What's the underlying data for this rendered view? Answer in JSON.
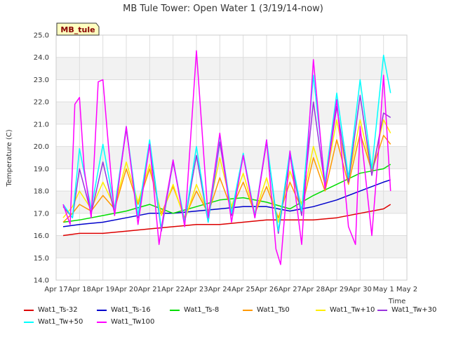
{
  "chart_data": {
    "type": "line",
    "title": "MB Tule Tower: Open Water 1 (3/19/14-now)",
    "station_label": "MB_tule",
    "xlabel": "Time",
    "ylabel": "Temperature (C)",
    "ylim": [
      14.0,
      25.0
    ],
    "xlim": [
      "2014-04-17",
      "2014-05-02"
    ],
    "yticks": [
      "14.0",
      "15.0",
      "16.0",
      "17.0",
      "18.0",
      "19.0",
      "20.0",
      "21.0",
      "22.0",
      "23.0",
      "24.0",
      "25.0"
    ],
    "xticks": [
      "Apr 17",
      "Apr 18",
      "Apr 19",
      "Apr 20",
      "Apr 21",
      "Apr 22",
      "Apr 23",
      "Apr 24",
      "Apr 25",
      "Apr 26",
      "Apr 27",
      "Apr 28",
      "Apr 29",
      "Apr 30",
      "May 1",
      "May 2"
    ],
    "x_dates": [
      "2014-04-17",
      "2014-04-18",
      "2014-04-19",
      "2014-04-20",
      "2014-04-21",
      "2014-04-22",
      "2014-04-23",
      "2014-04-24",
      "2014-04-25",
      "2014-04-26",
      "2014-04-27",
      "2014-04-28",
      "2014-04-29",
      "2014-04-30",
      "2014-05-01",
      "2014-05-02"
    ],
    "x_step": "day",
    "grid": true,
    "legend_position": "bottom",
    "series": [
      {
        "name": "Wat1_Ts-32",
        "color": "#dd0000",
        "x": [
          0.3,
          1.0,
          2.0,
          3.0,
          4.0,
          5.0,
          6.0,
          7.0,
          8.0,
          9.0,
          10.0,
          11.0,
          12.0,
          13.0,
          14.0,
          14.3
        ],
        "values": [
          16.0,
          16.1,
          16.1,
          16.2,
          16.3,
          16.4,
          16.5,
          16.5,
          16.6,
          16.7,
          16.7,
          16.7,
          16.8,
          17.0,
          17.2,
          17.4
        ]
      },
      {
        "name": "Wat1_Ts-16",
        "color": "#0000cc",
        "x": [
          0.3,
          1.0,
          2.0,
          3.0,
          4.0,
          5.0,
          6.0,
          7.0,
          8.0,
          9.0,
          10.0,
          11.0,
          12.0,
          13.0,
          14.0,
          14.3
        ],
        "values": [
          16.4,
          16.5,
          16.6,
          16.8,
          17.0,
          17.0,
          17.1,
          17.2,
          17.3,
          17.3,
          17.1,
          17.3,
          17.6,
          18.0,
          18.4,
          18.5
        ]
      },
      {
        "name": "Wat1_Ts-8",
        "color": "#00dd00",
        "x": [
          0.3,
          1.0,
          2.0,
          3.0,
          4.0,
          5.0,
          6.0,
          7.0,
          8.0,
          9.0,
          10.0,
          11.0,
          12.0,
          13.0,
          14.0,
          14.3
        ],
        "values": [
          16.6,
          16.7,
          16.9,
          17.1,
          17.4,
          17.0,
          17.3,
          17.6,
          17.7,
          17.5,
          17.2,
          17.8,
          18.3,
          18.8,
          19.0,
          19.2
        ]
      },
      {
        "name": "Wat1_Ts0",
        "color": "#ff9900",
        "x": [
          0.3,
          0.7,
          1.0,
          1.5,
          2.0,
          2.5,
          3.0,
          3.5,
          4.0,
          4.5,
          5.0,
          5.5,
          6.0,
          6.5,
          7.0,
          7.5,
          8.0,
          8.5,
          9.0,
          9.5,
          10.0,
          10.5,
          11.0,
          11.5,
          12.0,
          12.5,
          13.0,
          13.5,
          14.0,
          14.3
        ],
        "values": [
          16.6,
          17.0,
          17.4,
          17.1,
          17.8,
          17.2,
          19.0,
          17.4,
          19.0,
          17.0,
          18.2,
          16.8,
          18.0,
          17.0,
          18.6,
          17.2,
          18.4,
          17.0,
          18.2,
          16.8,
          18.4,
          17.2,
          19.5,
          18.0,
          20.3,
          18.3,
          20.6,
          18.9,
          20.5,
          20.1
        ]
      },
      {
        "name": "Wat1_Tw+10",
        "color": "#ffee00",
        "x": [
          0.3,
          0.7,
          1.0,
          1.5,
          2.0,
          2.5,
          3.0,
          3.5,
          4.0,
          4.5,
          5.0,
          5.5,
          6.0,
          6.5,
          7.0,
          7.5,
          8.0,
          8.5,
          9.0,
          9.5,
          10.0,
          10.5,
          11.0,
          11.5,
          12.0,
          12.5,
          13.0,
          13.5,
          14.0,
          14.3
        ],
        "values": [
          16.8,
          17.3,
          18.0,
          17.2,
          18.4,
          17.3,
          19.3,
          17.5,
          19.2,
          16.9,
          18.3,
          16.7,
          18.3,
          17.0,
          19.5,
          17.3,
          18.8,
          17.0,
          18.6,
          16.6,
          18.9,
          17.4,
          20.0,
          18.3,
          21.2,
          18.5,
          21.2,
          18.9,
          21.2,
          20.6
        ]
      },
      {
        "name": "Wat1_Tw+30",
        "color": "#9933dd",
        "x": [
          0.3,
          0.7,
          1.0,
          1.5,
          2.0,
          2.5,
          3.0,
          3.5,
          4.0,
          4.5,
          5.0,
          5.5,
          6.0,
          6.5,
          7.0,
          7.5,
          8.0,
          8.5,
          9.0,
          9.5,
          10.0,
          10.5,
          11.0,
          11.5,
          12.0,
          12.5,
          13.0,
          13.5,
          14.0,
          14.3
        ],
        "values": [
          17.3,
          16.8,
          19.0,
          17.0,
          19.3,
          17.0,
          20.8,
          16.8,
          20.1,
          16.2,
          19.3,
          16.6,
          19.6,
          16.6,
          20.2,
          16.9,
          19.6,
          16.8,
          20.2,
          16.1,
          19.6,
          16.9,
          22.0,
          18.2,
          21.8,
          18.4,
          22.3,
          18.7,
          21.5,
          21.3
        ]
      },
      {
        "name": "Wat1_Tw+50",
        "color": "#00ffff",
        "x": [
          0.3,
          0.7,
          1.0,
          1.5,
          2.0,
          2.5,
          3.0,
          3.5,
          4.0,
          4.5,
          5.0,
          5.5,
          6.0,
          6.5,
          7.0,
          7.5,
          8.0,
          8.5,
          9.0,
          9.5,
          10.0,
          10.5,
          11.0,
          11.5,
          12.0,
          12.5,
          13.0,
          13.5,
          14.0,
          14.3
        ],
        "values": [
          17.4,
          16.8,
          19.9,
          17.2,
          20.1,
          17.2,
          20.9,
          16.9,
          20.3,
          16.3,
          19.4,
          16.6,
          20.0,
          16.6,
          20.5,
          17.0,
          19.7,
          16.9,
          20.3,
          16.2,
          19.8,
          17.1,
          23.2,
          18.4,
          22.4,
          18.6,
          23.0,
          19.0,
          24.1,
          22.4
        ]
      },
      {
        "name": "Wat1_Tw100",
        "color": "#ff00ff",
        "x": [
          0.3,
          0.6,
          0.8,
          1.0,
          1.2,
          1.5,
          1.8,
          2.0,
          2.2,
          2.5,
          3.0,
          3.5,
          4.0,
          4.4,
          4.6,
          5.0,
          5.5,
          6.0,
          6.5,
          7.0,
          7.5,
          8.0,
          8.5,
          9.0,
          9.4,
          9.6,
          10.0,
          10.5,
          11.0,
          11.5,
          12.0,
          12.5,
          12.8,
          13.0,
          13.5,
          13.8,
          14.0,
          14.3
        ],
        "values": [
          17.4,
          16.5,
          21.9,
          22.2,
          19.0,
          16.8,
          22.9,
          23.0,
          20.5,
          16.9,
          20.9,
          16.5,
          20.1,
          15.6,
          17.0,
          19.4,
          16.4,
          24.3,
          16.8,
          20.6,
          16.6,
          19.6,
          16.8,
          20.3,
          15.4,
          14.7,
          19.8,
          15.6,
          23.9,
          18.1,
          22.1,
          16.4,
          15.6,
          20.9,
          16.0,
          20.0,
          23.2,
          18.0
        ]
      }
    ]
  }
}
